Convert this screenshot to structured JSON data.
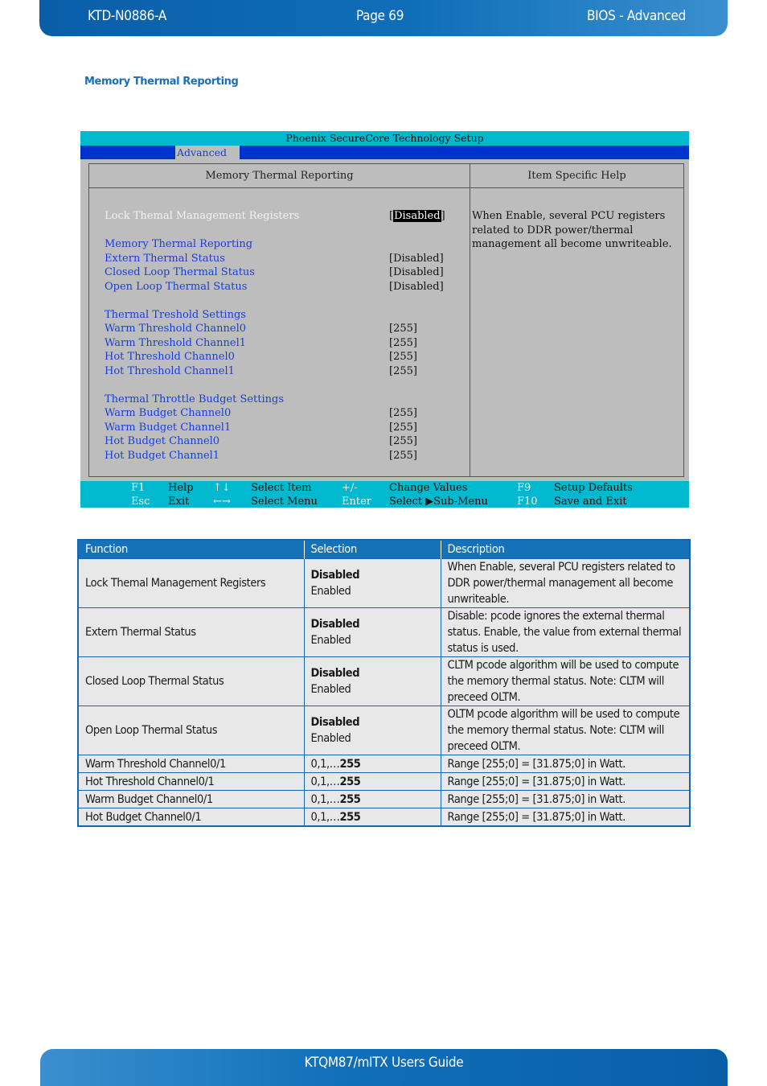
{
  "header": {
    "doc_id": "KTD-N0886-A",
    "page": "Page 69",
    "section": "BIOS  - Advanced"
  },
  "section_title": "Memory Thermal Reporting",
  "bios": {
    "title": "Phoenix SecureCore Technology Setup",
    "active_tab": "Advanced",
    "left_heading": "Memory Thermal Reporting",
    "right_heading": "Item Specific Help",
    "rows": [
      {
        "label": "Lock Themal Management Registers",
        "value": "Disabled",
        "selected": true
      },
      {
        "label": "Memory Thermal Reporting",
        "value": ""
      },
      {
        "label": "Extern Thermal Status",
        "value": "[Disabled]"
      },
      {
        "label": "Closed Loop Thermal Status",
        "value": "[Disabled]"
      },
      {
        "label": "Open Loop Thermal Status",
        "value": "[Disabled]"
      },
      {
        "label": "Thermal Treshold Settings",
        "value": ""
      },
      {
        "label": "Warm Threshold Channel0",
        "value": "[255]"
      },
      {
        "label": "Warm Threshold Channel1",
        "value": "[255]"
      },
      {
        "label": "Hot Threshold Channel0",
        "value": "[255]"
      },
      {
        "label": "Hot Threshold Channel1",
        "value": "[255]"
      },
      {
        "label": "Thermal Throttle Budget Settings",
        "value": ""
      },
      {
        "label": "Warm Budget Channel0",
        "value": "[255]"
      },
      {
        "label": "Warm Budget Channel1",
        "value": "[255]"
      },
      {
        "label": "Hot Budget Channel0",
        "value": "[255]"
      },
      {
        "label": "Hot Budget Channel1",
        "value": "[255]"
      }
    ],
    "help_text": "When Enable, several PCU registers related to DDR power/thermal management all become unwriteable.",
    "footer": {
      "row1": [
        {
          "key": "F1",
          "desc": "Help"
        },
        {
          "key": "↑↓",
          "desc": "Select Item"
        },
        {
          "key": "+/-",
          "desc": "Change Values"
        },
        {
          "key": "F9",
          "desc": "Setup Defaults"
        }
      ],
      "row2": [
        {
          "key": "Esc",
          "desc": "Exit"
        },
        {
          "key": "←→",
          "desc": "Select Menu"
        },
        {
          "key": "Enter",
          "desc": "Select ▶Sub-Menu"
        },
        {
          "key": "F10",
          "desc": "Save and Exit"
        }
      ]
    }
  },
  "table": {
    "headers": [
      "Function",
      "Selection",
      "Description"
    ],
    "rows": [
      {
        "function": "Lock Themal Management Registers",
        "sel_bold": "Disabled",
        "sel_other": "Enabled",
        "desc": "When Enable, several PCU registers related to DDR power/thermal management all become unwriteable."
      },
      {
        "function": "Extern Thermal Status",
        "sel_bold": "Disabled",
        "sel_other": "Enabled",
        "desc": "Disable: pcode ignores the external thermal status. Enable, the value from external thermal status is used."
      },
      {
        "function": "Closed Loop Thermal Status",
        "sel_bold": "Disabled",
        "sel_other": "Enabled",
        "desc": "CLTM pcode algorithm will be used to compute the memory thermal status. Note: CLTM will preceed OLTM."
      },
      {
        "function": "Open Loop Thermal Status",
        "sel_bold": "Disabled",
        "sel_other": "Enabled",
        "desc": "OLTM pcode algorithm will be used to compute the memory thermal status. Note: CLTM will preceed OLTM."
      },
      {
        "function": "Warm Threshold Channel0/1",
        "sel_prefix": "0,1,…",
        "sel_bold": "255",
        "desc": "Range [255;0] = [31.875;0] in Watt."
      },
      {
        "function": "Hot Threshold Channel0/1",
        "sel_prefix": "0,1,…",
        "sel_bold": "255",
        "desc": "Range [255;0] = [31.875;0] in Watt."
      },
      {
        "function": "Warm Budget Channel0/1",
        "sel_prefix": "0,1,…",
        "sel_bold": "255",
        "desc": "Range [255;0] = [31.875;0] in Watt."
      },
      {
        "function": "Hot Budget Channel0/1",
        "sel_prefix": "0,1,…",
        "sel_bold": "255",
        "desc": "Range [255;0] = [31.875;0] in Watt."
      }
    ]
  },
  "footer": {
    "title": "KTQM87/mITX Users Guide"
  }
}
